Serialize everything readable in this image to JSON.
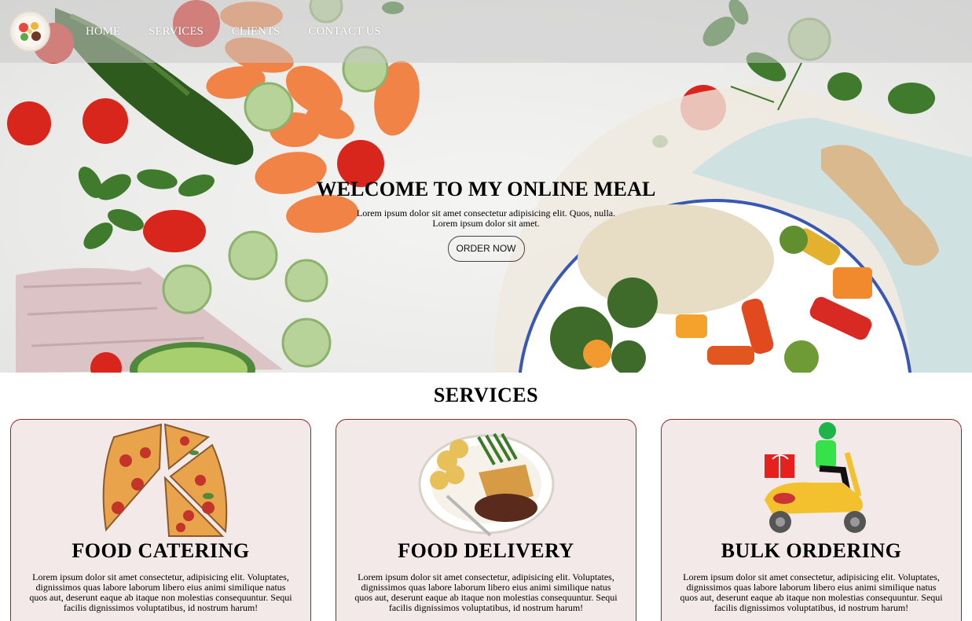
{
  "nav": {
    "links": [
      "HOME",
      "SERVICES",
      "CLIENTS",
      "CONTACT US"
    ]
  },
  "hero": {
    "title": "WELCOME TO MY ONLINE MEAL",
    "text": "Lorem ipsum dolor sit amet consectetur adipisicing elit. Quos, nulla. Lorem ipsum dolor sit amet.",
    "button_label": "ORDER NOW"
  },
  "services": {
    "title": "SERVICES",
    "cards": [
      {
        "title": "FOOD CATERING",
        "icon": "pizza-slices-image",
        "text": "Lorem ipsum dolor sit amet consectetur, adipisicing elit. Voluptates, dignissimos quas labore laborum libero eius animi similique natus quos aut, deserunt eaque ab itaque non molestias consequuntur. Sequi facilis dignissimos voluptatibus, id nostrum harum!"
      },
      {
        "title": "FOOD DELIVERY",
        "icon": "meal-plate-image",
        "text": "Lorem ipsum dolor sit amet consectetur, adipisicing elit. Voluptates, dignissimos quas labore laborum libero eius animi similique natus quos aut, deserunt eaque ab itaque non molestias consequuntur. Sequi facilis dignissimos voluptatibus, id nostrum harum!"
      },
      {
        "title": "BULK ORDERING",
        "icon": "delivery-scooter-image",
        "text": "Lorem ipsum dolor sit amet consectetur, adipisicing elit. Voluptates, dignissimos quas labore laborum libero eius animi similique natus quos aut, deserunt eaque ab itaque non molestias consequuntur. Sequi facilis dignissimos voluptatibus, id nostrum harum!"
      }
    ]
  },
  "colors": {
    "card_background": "#f3e9e9",
    "card_border": "#8a2a2a",
    "navbar_overlay": "rgba(200,200,200,0.55)"
  }
}
